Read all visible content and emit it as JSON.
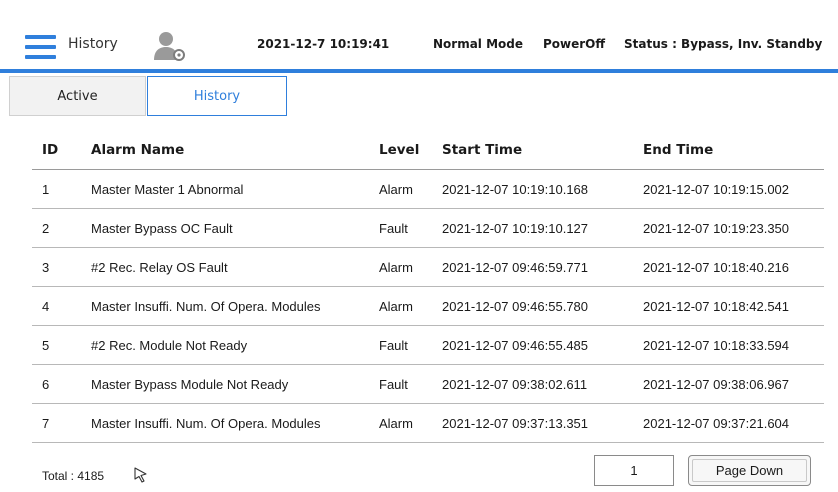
{
  "header": {
    "title": "History",
    "datetime": "2021-12-7 10:19:41",
    "mode": "Normal Mode",
    "power": "PowerOff",
    "status": "Status : Bypass, Inv. Standby",
    "menu_icon": "hamburger-menu-icon",
    "user_icon": "user-settings-icon",
    "accent_color": "#2f7fdc"
  },
  "tabs": [
    {
      "label": "Active",
      "selected": false
    },
    {
      "label": "History",
      "selected": true
    }
  ],
  "table": {
    "columns": [
      "ID",
      "Alarm Name",
      "Level",
      "Start Time",
      "End Time"
    ],
    "rows": [
      {
        "id": "1",
        "name": "Master Master 1 Abnormal",
        "level": "Alarm",
        "start": "2021-12-07 10:19:10.168",
        "end": "2021-12-07 10:19:15.002"
      },
      {
        "id": "2",
        "name": "Master Bypass OC Fault",
        "level": "Fault",
        "start": "2021-12-07 10:19:10.127",
        "end": "2021-12-07 10:19:23.350"
      },
      {
        "id": "3",
        "name": "#2 Rec. Relay OS Fault",
        "level": "Alarm",
        "start": "2021-12-07 09:46:59.771",
        "end": "2021-12-07 10:18:40.216"
      },
      {
        "id": "4",
        "name": "Master Insuffi. Num. Of Opera. Modules",
        "level": "Alarm",
        "start": "2021-12-07 09:46:55.780",
        "end": "2021-12-07 10:18:42.541"
      },
      {
        "id": "5",
        "name": "#2 Rec. Module Not Ready",
        "level": "Fault",
        "start": "2021-12-07 09:46:55.485",
        "end": "2021-12-07 10:18:33.594"
      },
      {
        "id": "6",
        "name": "Master Bypass Module Not Ready",
        "level": "Fault",
        "start": "2021-12-07 09:38:02.611",
        "end": "2021-12-07 09:38:06.967"
      },
      {
        "id": "7",
        "name": "Master Insuffi. Num. Of Opera. Modules",
        "level": "Alarm",
        "start": "2021-12-07 09:37:13.351",
        "end": "2021-12-07 09:37:21.604"
      }
    ]
  },
  "footer": {
    "total": "Total : 4185",
    "page_number": "1",
    "page_down_label": "Page Down",
    "cursor_icon": "mouse-pointer-icon"
  }
}
